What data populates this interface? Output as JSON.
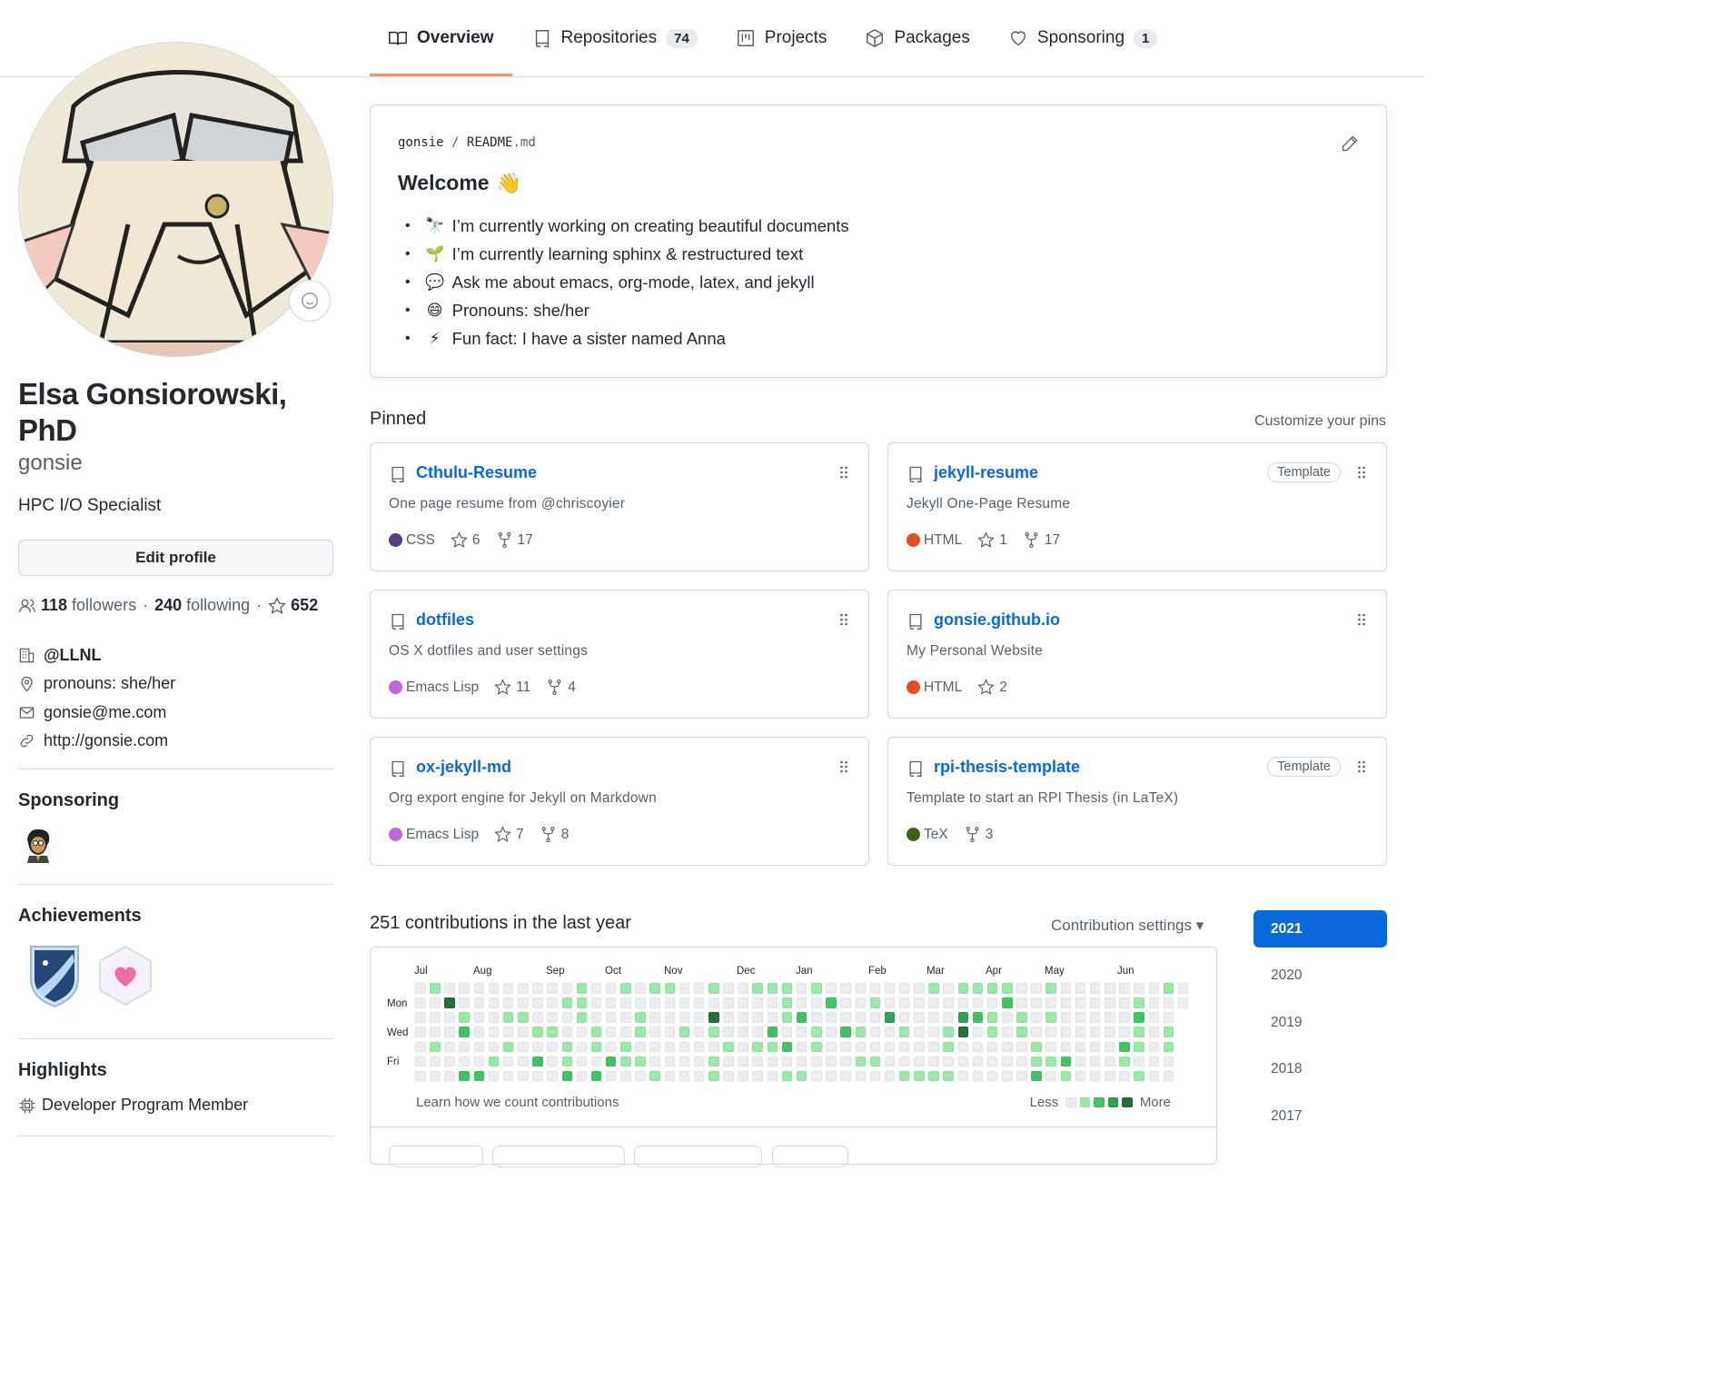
{
  "nav": {
    "tabs": [
      {
        "label": "Overview",
        "icon": "book-icon",
        "active": true
      },
      {
        "label": "Repositories",
        "icon": "repo-icon",
        "count": "74"
      },
      {
        "label": "Projects",
        "icon": "project-icon"
      },
      {
        "label": "Packages",
        "icon": "package-icon"
      },
      {
        "label": "Sponsoring",
        "icon": "heart-icon",
        "count": "1"
      }
    ]
  },
  "profile": {
    "full_name": "Elsa Gonsiorowski, PhD",
    "username": "gonsie",
    "bio": "HPC I/O Specialist",
    "edit_label": "Edit profile",
    "followers_count": "118",
    "followers_label": "followers",
    "following_count": "240",
    "following_label": "following",
    "stars_count": "652",
    "org": "@LLNL",
    "location": "pronouns: she/her",
    "email": "gonsie@me.com",
    "website": "http://gonsie.com"
  },
  "sidebar": {
    "sponsoring_title": "Sponsoring",
    "achievements_title": "Achievements",
    "highlights_title": "Highlights",
    "highlight_item": "Developer Program Member"
  },
  "readme": {
    "owner": "gonsie",
    "sep": "/",
    "file": "README",
    "ext": ".md",
    "heading": "Welcome",
    "items": [
      {
        "emoji": "🔭",
        "text": "I’m currently working on creating beautiful documents"
      },
      {
        "emoji": "🌱",
        "text": "I’m currently learning sphinx & restructured text"
      },
      {
        "emoji": "💬",
        "text": "Ask me about emacs, org-mode, latex, and jekyll"
      },
      {
        "emoji": "😄",
        "text": "Pronouns: she/her"
      },
      {
        "emoji": "⚡",
        "text": "Fun fact: I have a sister named Anna"
      }
    ]
  },
  "pinned": {
    "title": "Pinned",
    "customize": "Customize your pins",
    "repos": [
      {
        "name": "Cthulu-Resume",
        "desc": "One page resume from @chriscoyier",
        "lang": "CSS",
        "lang_color": "#563d7c",
        "stars": "6",
        "forks": "17",
        "template": ""
      },
      {
        "name": "jekyll-resume",
        "desc": "Jekyll One-Page Resume",
        "lang": "HTML",
        "lang_color": "#e34c26",
        "stars": "1",
        "forks": "17",
        "template": "Template"
      },
      {
        "name": "dotfiles",
        "desc": "OS X dotfiles and user settings",
        "lang": "Emacs Lisp",
        "lang_color": "#c065db",
        "stars": "11",
        "forks": "4",
        "template": ""
      },
      {
        "name": "gonsie.github.io",
        "desc": "My Personal Website",
        "lang": "HTML",
        "lang_color": "#e34c26",
        "stars": "2",
        "forks": "",
        "template": ""
      },
      {
        "name": "ox-jekyll-md",
        "desc": "Org export engine for Jekyll on Markdown",
        "lang": "Emacs Lisp",
        "lang_color": "#c065db",
        "stars": "7",
        "forks": "8",
        "template": ""
      },
      {
        "name": "rpi-thesis-template",
        "desc": "Template to start an RPI Thesis (in LaTeX)",
        "lang": "TeX",
        "lang_color": "#3d6117",
        "stars": "",
        "forks": "3",
        "template": "Template"
      }
    ]
  },
  "contributions": {
    "title": "251 contributions in the last year",
    "settings": "Contribution settings ▾",
    "months": [
      "Jul",
      "Aug",
      "Sep",
      "Oct",
      "Nov",
      "Dec",
      "Jan",
      "Feb",
      "Mar",
      "Apr",
      "May",
      "Jun"
    ],
    "day_labels": [
      "Mon",
      "Wed",
      "Fri"
    ],
    "learn": "Learn how we count contributions",
    "less": "Less",
    "more": "More",
    "years": [
      "2021",
      "2020",
      "2019",
      "2018",
      "2017"
    ],
    "colors": [
      "#ebedf0",
      "#9be9a8",
      "#40c463",
      "#30a14e",
      "#216e39"
    ]
  }
}
